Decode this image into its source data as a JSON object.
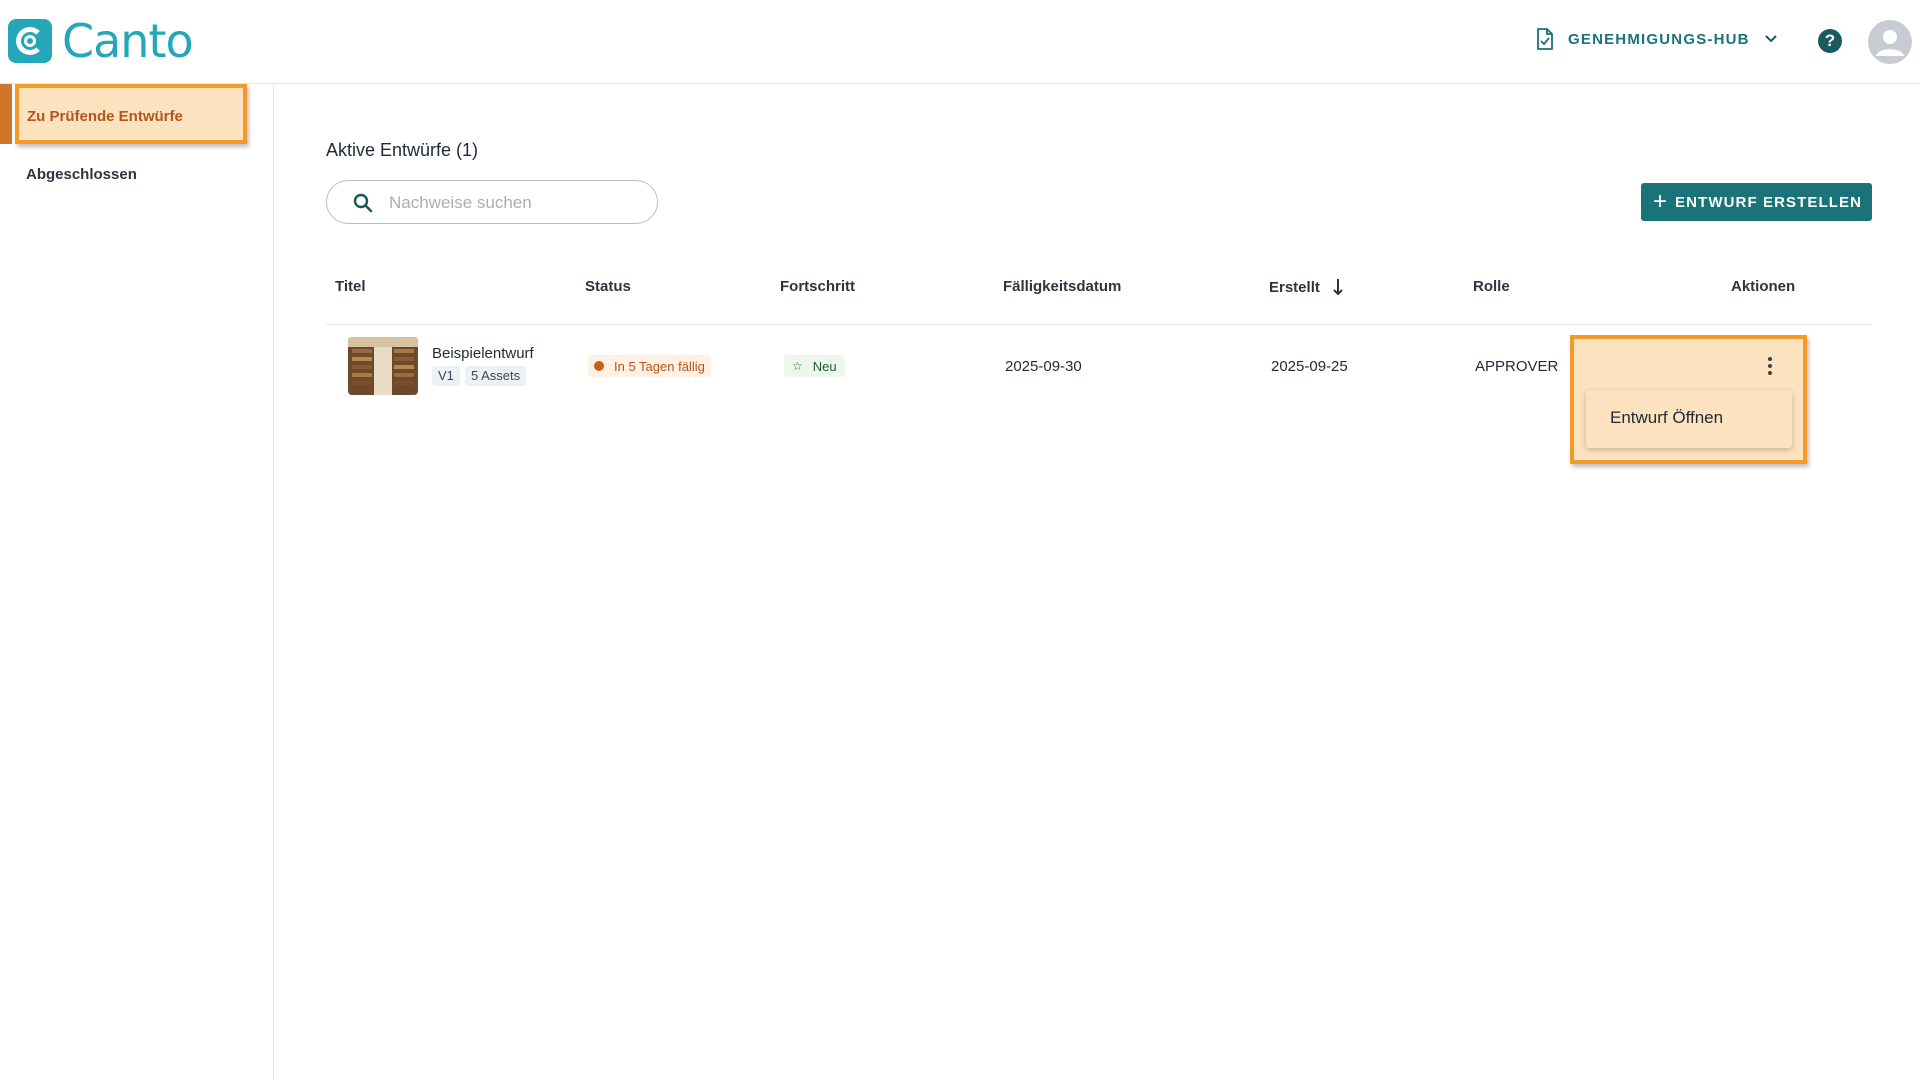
{
  "app": {
    "brand": "Canto",
    "brand_color": "#23a7b9",
    "accent_color": "#1a7378"
  },
  "header": {
    "hub_label": "GENEHMIGUNGS-HUB",
    "hub_icon": "document-check-icon",
    "help_icon": "help-circle-icon",
    "avatar_icon": "user-avatar-icon"
  },
  "sidebar": {
    "items": [
      {
        "label": "Zu Prüfende Entwürfe",
        "active": true
      },
      {
        "label": "Abgeschlossen",
        "active": false
      }
    ]
  },
  "main": {
    "section_title": "Aktive Entwürfe (1)",
    "search": {
      "placeholder": "Nachweise suchen",
      "value": ""
    },
    "create_button": {
      "label": "ENTWURF ERSTELLEN",
      "icon": "plus-icon"
    }
  },
  "table": {
    "columns": [
      "Titel",
      "Status",
      "Fortschritt",
      "Fälligkeitsdatum",
      "Erstellt",
      "Rolle",
      "Aktionen"
    ],
    "sort": {
      "column": "Erstellt",
      "direction": "descending"
    },
    "rows": [
      {
        "title": "Beispielentwurf",
        "version": "V1",
        "assets": "5 Assets",
        "status": "In 5 Tagen fällig",
        "progress": "Neu",
        "due_date": "2025-09-30",
        "created": "2025-09-25",
        "role": "APPROVER"
      }
    ]
  },
  "actions_menu": {
    "open": true,
    "items": [
      "Entwurf Öffnen"
    ]
  }
}
